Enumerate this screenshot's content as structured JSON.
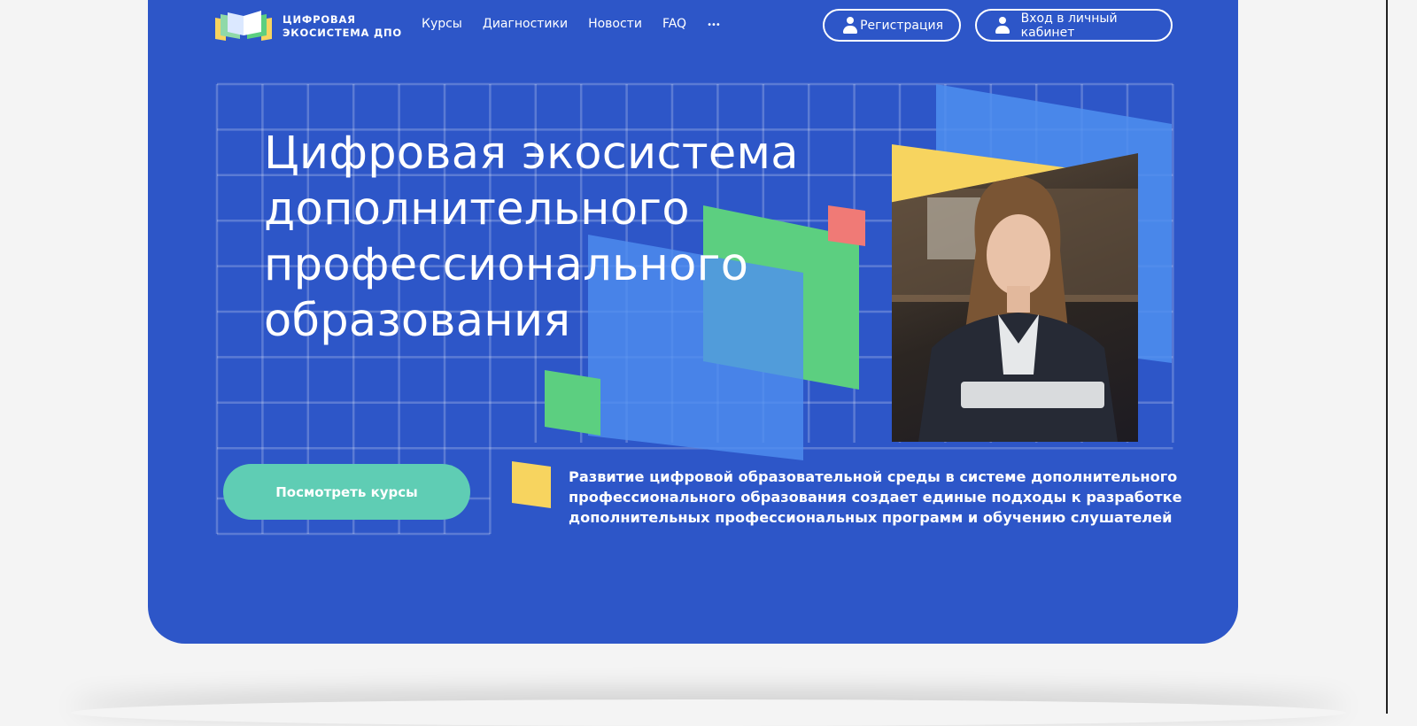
{
  "logo": {
    "line1": "ЦИФРОВАЯ",
    "line2": "ЭКОСИСТЕМА ДПО"
  },
  "nav": {
    "items": [
      "Курсы",
      "Диагностики",
      "Новости",
      "FAQ"
    ],
    "more": "•••"
  },
  "auth": {
    "register": "Регистрация",
    "login": "Вход в личный кабинет"
  },
  "hero": {
    "title_lines": [
      "Цифровая экосистема",
      "дополнительного",
      "профессионального",
      "образования"
    ],
    "cta": "Посмотреть курсы",
    "description_lines": [
      "Развитие цифровой образовательной среды в системе дополнительного",
      "профессионального образования создает единые подходы к разработке",
      "дополнительных профессиональных программ и обучению слушателей"
    ]
  },
  "colors": {
    "brand": "#2d56c8",
    "accent": "#5fcdb4",
    "green": "#5ccf80",
    "yellow": "#f7d45f",
    "red": "#f07a76"
  }
}
